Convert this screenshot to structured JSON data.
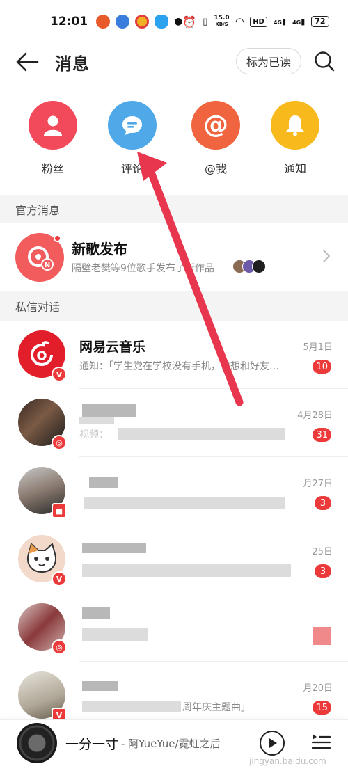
{
  "status_bar": {
    "time": "12:01",
    "network_speed": "15.0",
    "network_unit": "KB/S",
    "hd": "HD",
    "signal1": "4G",
    "signal2": "4G",
    "battery": "72"
  },
  "header": {
    "title": "消息",
    "mark_read_label": "标为已读"
  },
  "categories": [
    {
      "label": "粉丝",
      "icon": "user-icon",
      "color": "#f24a5b"
    },
    {
      "label": "评论",
      "icon": "comment-icon",
      "color": "#4fa8e8"
    },
    {
      "label": "@我",
      "icon": "at-icon",
      "color": "#f0643f"
    },
    {
      "label": "通知",
      "icon": "bell-icon",
      "color": "#f8b91c"
    }
  ],
  "sections": {
    "official": "官方消息",
    "private": "私信对话"
  },
  "official_item": {
    "title": "新歌发布",
    "subtitle": "隔壁老樊等9位歌手发布了新作品"
  },
  "chats": [
    {
      "name": "网易云音乐",
      "preview": "通知：「学生党在学校没有手机，但想和好友…",
      "date": "5月1日",
      "unread": "10"
    },
    {
      "name": "",
      "preview": "视频：",
      "date": "4月28日",
      "unread": "31"
    },
    {
      "name": "",
      "preview": "",
      "date": "月27日",
      "unread": "3"
    },
    {
      "name": "",
      "preview": "",
      "date": "25日",
      "unread": "3"
    },
    {
      "name": "",
      "preview": "",
      "date": "",
      "unread": ""
    },
    {
      "name": "",
      "preview": "周年庆主题曲」",
      "date": "月20日",
      "unread": "15"
    }
  ],
  "player": {
    "song": "一分一寸",
    "artist": "- 阿YueYue/霓虹之后"
  },
  "watermark": "jingyan.baidu.com",
  "colors": {
    "accent_red": "#ec3a3a",
    "annotation_arrow": "#e8364f"
  }
}
